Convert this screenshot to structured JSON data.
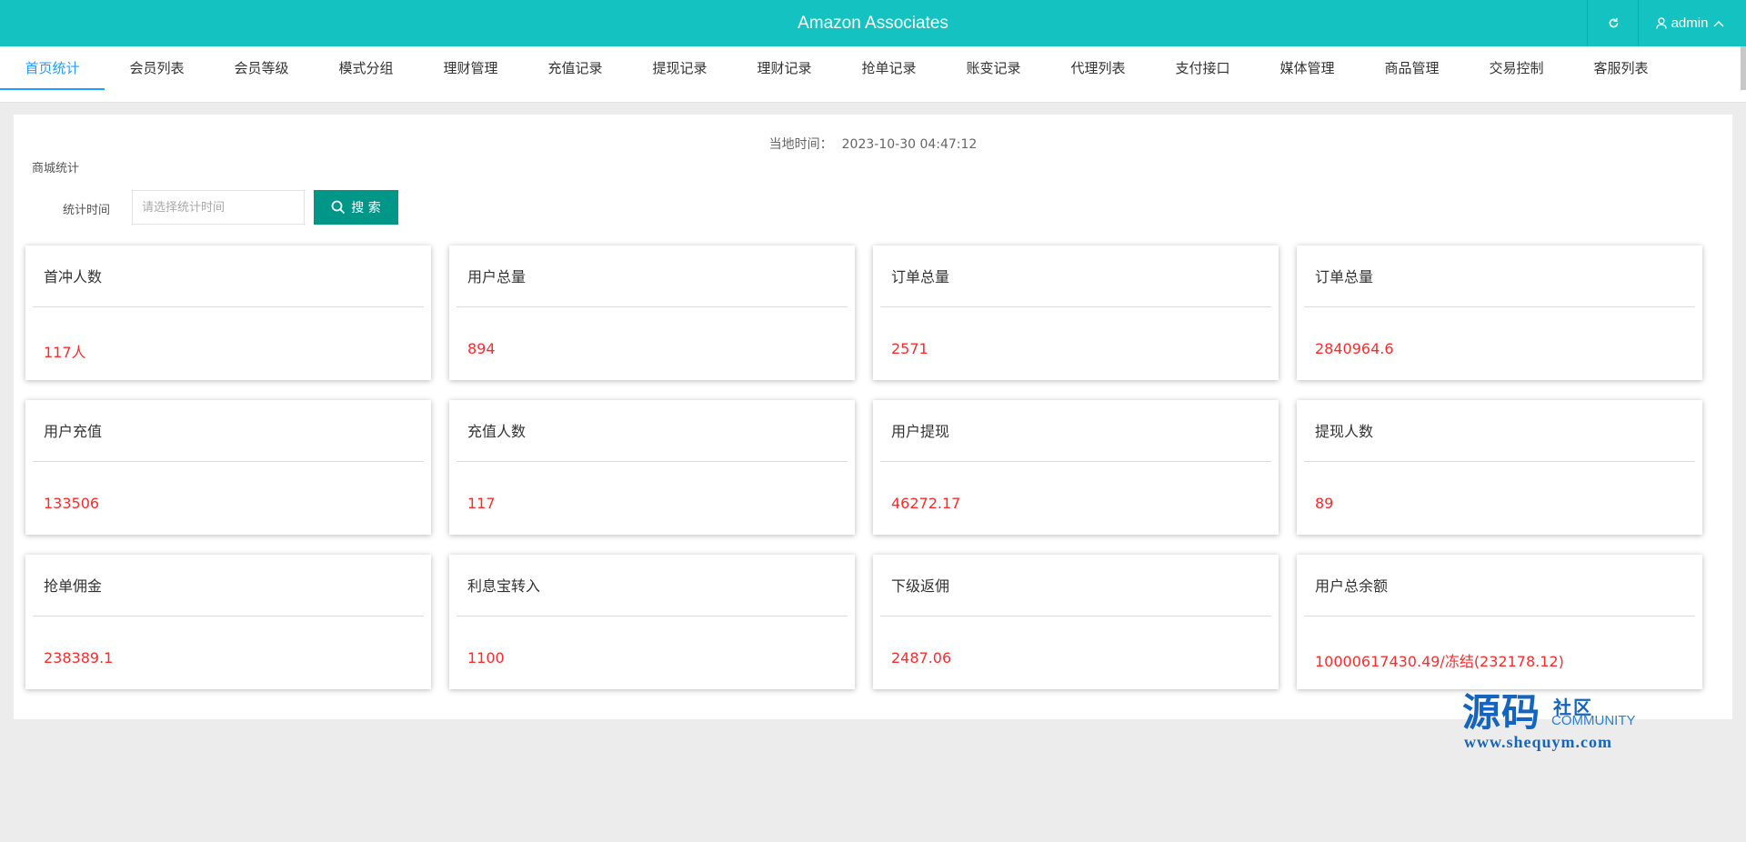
{
  "header": {
    "title": "Amazon Associates",
    "user": "admin"
  },
  "nav": {
    "tabs": [
      {
        "label": "首页统计",
        "active": true
      },
      {
        "label": "会员列表"
      },
      {
        "label": "会员等级"
      },
      {
        "label": "模式分组"
      },
      {
        "label": "理财管理"
      },
      {
        "label": "充值记录"
      },
      {
        "label": "提现记录"
      },
      {
        "label": "理财记录"
      },
      {
        "label": "抢单记录"
      },
      {
        "label": "账变记录"
      },
      {
        "label": "代理列表"
      },
      {
        "label": "支付接口"
      },
      {
        "label": "媒体管理"
      },
      {
        "label": "商品管理"
      },
      {
        "label": "交易控制"
      },
      {
        "label": "客服列表"
      }
    ]
  },
  "main": {
    "local_time_label": "当地时间：",
    "local_time_value": "2023-10-30 04:47:12",
    "section_title": "商城统计",
    "filter": {
      "label": "统计时间",
      "placeholder": "请选择统计时间",
      "value": "",
      "search_label": "搜 索"
    },
    "cards": [
      {
        "title": "首冲人数",
        "value": "117人"
      },
      {
        "title": "用户总量",
        "value": "894"
      },
      {
        "title": "订单总量",
        "value": "2571"
      },
      {
        "title": "订单总量",
        "value": "2840964.6"
      },
      {
        "title": "用户充值",
        "value": "133506"
      },
      {
        "title": "充值人数",
        "value": "117"
      },
      {
        "title": "用户提现",
        "value": "46272.17"
      },
      {
        "title": "提现人数",
        "value": "89"
      },
      {
        "title": "抢单佣金",
        "value": "238389.1"
      },
      {
        "title": "利息宝转入",
        "value": "1100"
      },
      {
        "title": "下级返佣",
        "value": "2487.06"
      },
      {
        "title": "用户总余额",
        "value": "10000617430.49/冻结(232178.12)"
      }
    ]
  },
  "watermark": {
    "big": "源码",
    "small": "社区",
    "community": "COMMUNITY",
    "url": "www.shequym.com"
  },
  "colors": {
    "header_bg": "#14c3c1",
    "active_tab": "#1e9fff",
    "search_button": "#009688",
    "value_red": "#ff2a2a"
  }
}
